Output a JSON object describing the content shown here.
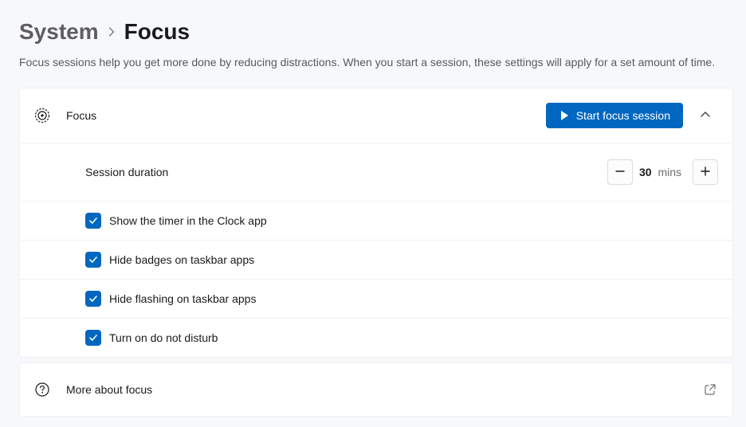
{
  "breadcrumb": {
    "parent": "System",
    "current": "Focus"
  },
  "description": "Focus sessions help you get more done by reducing distractions. When you start a session, these settings will apply for a set amount of time.",
  "focus_card": {
    "title": "Focus",
    "start_button": "Start focus session",
    "duration_label": "Session duration",
    "duration_value": "30",
    "duration_unit": "mins",
    "options": [
      {
        "label": "Show the timer in the Clock app",
        "checked": true
      },
      {
        "label": "Hide badges on taskbar apps",
        "checked": true
      },
      {
        "label": "Hide flashing on taskbar apps",
        "checked": true
      },
      {
        "label": "Turn on do not disturb",
        "checked": true
      }
    ]
  },
  "more_link": {
    "label": "More about focus"
  }
}
